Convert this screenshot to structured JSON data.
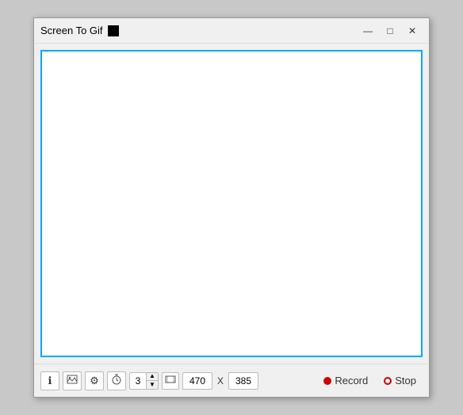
{
  "window": {
    "title": "Screen To Gif",
    "controls": {
      "minimize": "—",
      "maximize": "□",
      "close": "✕"
    }
  },
  "toolbar": {
    "info_icon": "ℹ",
    "image_icon": "🖼",
    "settings_icon": "⚙",
    "timer_icon": "⏱",
    "spinner_value": "3",
    "resize_icon": "⇔",
    "width_value": "470",
    "x_label": "X",
    "height_value": "385",
    "record_label": "Record",
    "stop_label": "Stop"
  }
}
